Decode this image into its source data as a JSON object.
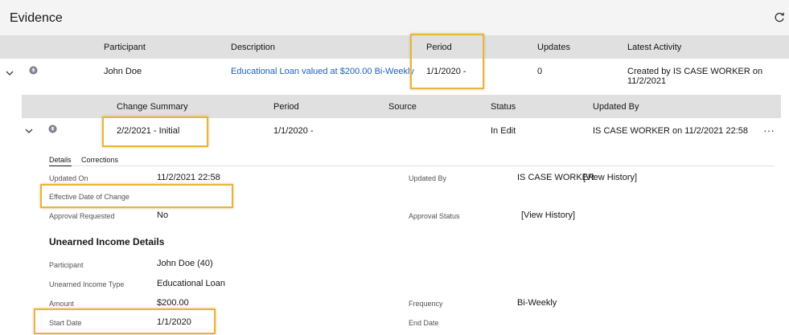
{
  "app": {
    "title": "Evidence"
  },
  "evidence_table": {
    "columns": [
      "Participant",
      "Description",
      "Period",
      "Updates",
      "Latest Activity"
    ],
    "row": {
      "participant": "John Doe",
      "description": "Educational Loan valued at $200.00 Bi-Weekly",
      "period": "1/1/2020 -",
      "updates": "0",
      "latest_activity": "Created by IS CASE WORKER on 11/2/2021"
    }
  },
  "change_table": {
    "columns": [
      "Change Summary",
      "Period",
      "Source",
      "Status",
      "Updated By"
    ],
    "row": {
      "change_summary": "2/2/2021 - Initial",
      "period": "1/1/2020 -",
      "source": "",
      "status": "In Edit",
      "updated_by": "IS CASE WORKER on 11/2/2021 22:58",
      "more": "···"
    }
  },
  "tabs": [
    "Details",
    "Corrections"
  ],
  "details": {
    "updated_on_label": "Updated On",
    "updated_on": "11/2/2021 22:58",
    "updated_by_label": "Updated By",
    "updated_by": "IS CASE WORKER",
    "view_history": "[View History]",
    "effective_date_label": "Effective Date of Change",
    "approval_requested_label": "Approval Requested",
    "approval_requested": "No",
    "approval_status_label": "Approval Status",
    "approval_status_link": "[View History]"
  },
  "income": {
    "section_title": "Unearned Income Details",
    "participant_label": "Participant",
    "participant": "John Doe (40)",
    "type_label": "Unearned Income Type",
    "type": "Educational Loan",
    "amount_label": "Amount",
    "amount": "$200.00",
    "frequency_label": "Frequency",
    "frequency": "Bi-Weekly",
    "start_date_label": "Start Date",
    "start_date": "1/1/2020",
    "end_date_label": "End Date"
  },
  "colors": {
    "highlight": "#e8b43a",
    "header_bg": "#e0e0e0",
    "link": "#1d5fbf"
  }
}
